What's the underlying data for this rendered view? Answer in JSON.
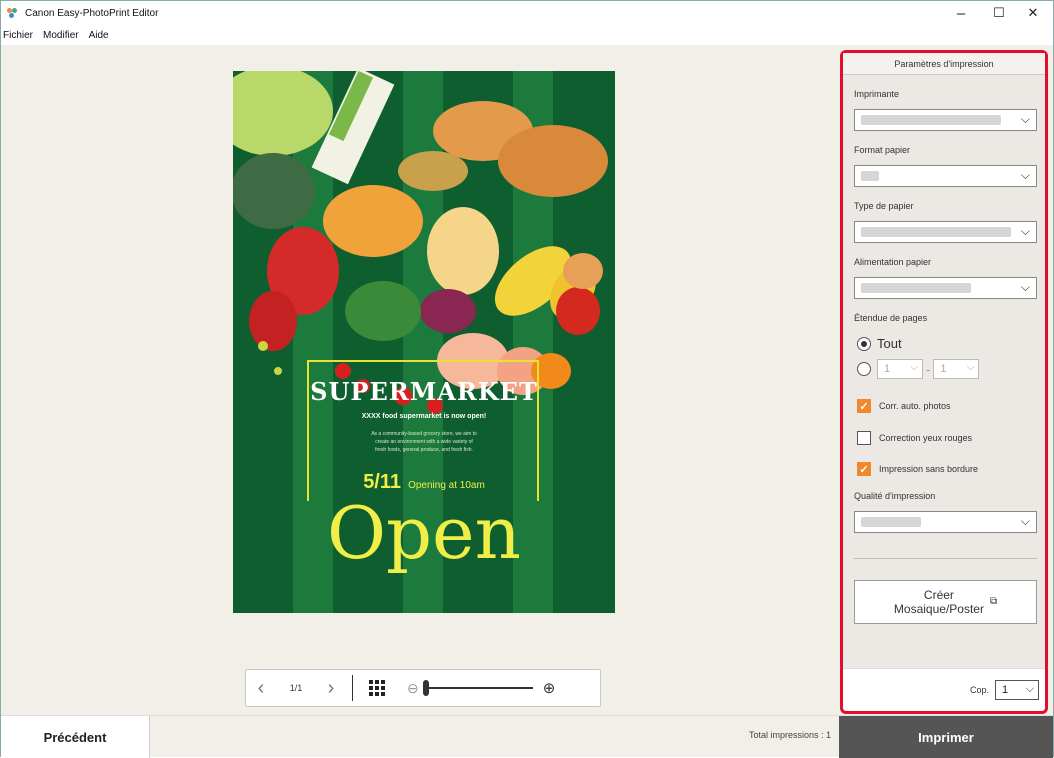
{
  "window": {
    "title": "Canon Easy-PhotoPrint Editor",
    "controls": {
      "minimize": "–",
      "maximize": "☐",
      "close": "✕"
    }
  },
  "menu": {
    "items": [
      "Fichier",
      "Modifier",
      "Aide"
    ]
  },
  "poster": {
    "heading": "SUPERMARKET",
    "subheading": "XXXX food supermarket is now open!",
    "body_lines": [
      "As a community-based grocery store, we aim to",
      "create an environment with a wide variety of",
      "fresh foods, general produce, and fresh fish."
    ],
    "date": "5/11",
    "opening": "Opening at 10am",
    "big_word": "Open"
  },
  "pager": {
    "page": "1/1",
    "prev_icon": "chevron-left-icon",
    "next_icon": "chevron-right-icon"
  },
  "panel": {
    "header": "Paramètres d'impression",
    "printer_label": "Imprimante",
    "paper_size_label": "Format papier",
    "paper_type_label": "Type de papier",
    "paper_source_label": "Alimentation papier",
    "page_range_label": "Étendue de pages",
    "range_all": "Tout",
    "range_from": "1",
    "range_to": "1",
    "auto_correct": "Corr. auto. photos",
    "red_eye": "Correction yeux rouges",
    "borderless": "Impression sans bordure",
    "quality_label": "Qualité d'impression",
    "mosaic_line1": "Créer",
    "mosaic_line2": "Mosaique/Poster",
    "copies_label": "Cop.",
    "copies_value": "1"
  },
  "states": {
    "auto_correct": true,
    "red_eye": false,
    "borderless": true,
    "range_all": true
  },
  "footer": {
    "prev_button": "Précédent",
    "total": "Total impressions : 1",
    "print_button": "Imprimer"
  },
  "colors": {
    "accent_orange": "#f0892b",
    "highlight_red": "#e20e2e",
    "poster_green": "#0e5e2f",
    "poster_yellow": "#f1ee48"
  }
}
